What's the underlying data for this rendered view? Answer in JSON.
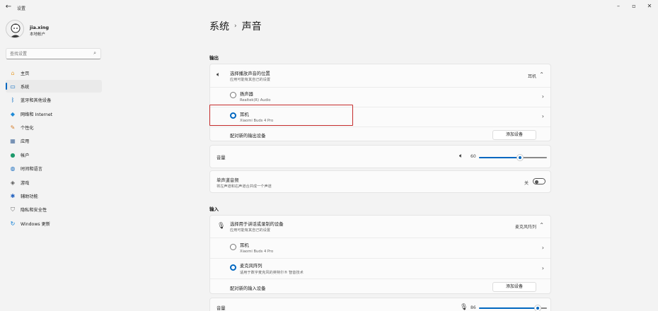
{
  "window": {
    "title": "设置"
  },
  "user": {
    "name": "jia.xing",
    "account": "本地帐户"
  },
  "search": {
    "placeholder": "查找设置"
  },
  "nav": [
    {
      "label": "主页",
      "icon": "home-icon",
      "color": "#e8a33b",
      "active": false
    },
    {
      "label": "系统",
      "icon": "system-icon",
      "color": "#0067c0",
      "active": true
    },
    {
      "label": "蓝牙和其他设备",
      "icon": "bluetooth-icon",
      "color": "#0067c0",
      "active": false
    },
    {
      "label": "网络和 Internet",
      "icon": "network-icon",
      "color": "#1e8ad6",
      "active": false
    },
    {
      "label": "个性化",
      "icon": "brush-icon",
      "color": "#d57d2a",
      "active": false
    },
    {
      "label": "应用",
      "icon": "apps-icon",
      "color": "#4a6f9e",
      "active": false
    },
    {
      "label": "帐户",
      "icon": "account-icon",
      "color": "#1d9a6c",
      "active": false
    },
    {
      "label": "时间和语言",
      "icon": "globe-icon",
      "color": "#1e6fbf",
      "active": false
    },
    {
      "label": "游戏",
      "icon": "game-icon",
      "color": "#555555",
      "active": false
    },
    {
      "label": "辅助功能",
      "icon": "accessibility-icon",
      "color": "#1e5fbf",
      "active": false
    },
    {
      "label": "隐私和安全性",
      "icon": "shield-icon",
      "color": "#6b6b6b",
      "active": false
    },
    {
      "label": "Windows 更新",
      "icon": "update-icon",
      "color": "#0078d4",
      "active": false
    }
  ],
  "breadcrumb": {
    "parent": "系统",
    "current": "声音"
  },
  "output": {
    "section_title": "输出",
    "choose_title": "选择播放声音的位置",
    "choose_sub": "应用可能有其自己的设置",
    "selected": "耳机",
    "devices": [
      {
        "name": "扬声器",
        "sub": "Realtek(R) Audio",
        "selected": false
      },
      {
        "name": "耳机",
        "sub": "Xiaomi Buds 4 Pro",
        "selected": true
      }
    ],
    "pair_label": "配对新的输出设备",
    "add_button": "添加设备",
    "volume_label": "音量",
    "volume_value": "60",
    "volume": 60,
    "mono_title": "单声道音频",
    "mono_sub": "将左声道和右声道合并成一个声道",
    "mono_state": "关"
  },
  "input": {
    "section_title": "输入",
    "choose_title": "选择用于讲话或录制的设备",
    "choose_sub": "应用可能有其自己的设置",
    "selected": "麦克风阵列",
    "devices": [
      {
        "name": "耳机",
        "sub": "Xiaomi Buds 4 Pro",
        "selected": false
      },
      {
        "name": "麦克风阵列",
        "sub": "适用于数字麦克风的英特尔® 智音技术",
        "selected": true
      }
    ],
    "pair_label": "配对新的输入设备",
    "add_button": "添加设备",
    "volume_label": "音量",
    "volume_value": "86",
    "volume": 86
  },
  "colors": {
    "accent": "#0067c0",
    "highlight": "#c42b2b"
  }
}
